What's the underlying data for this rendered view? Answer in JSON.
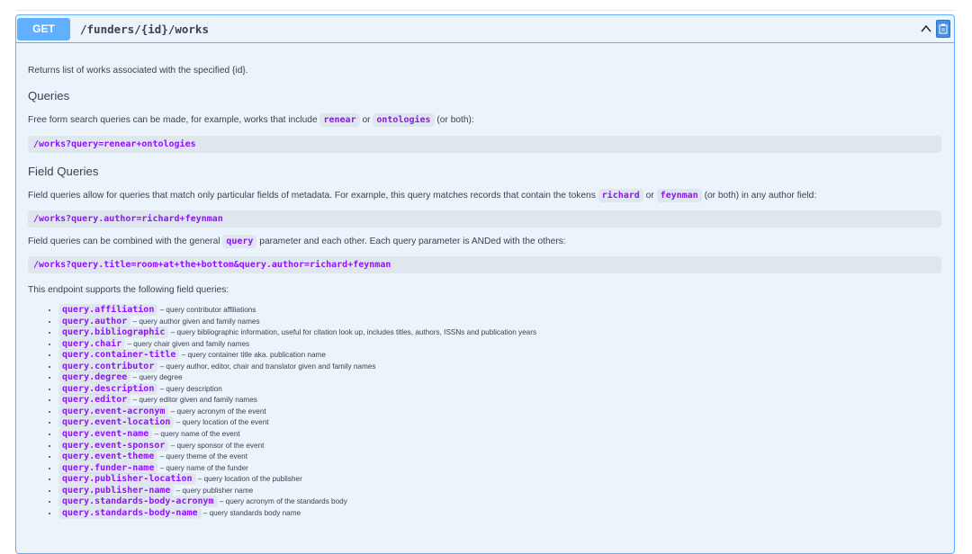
{
  "endpoint": {
    "method": "GET",
    "path": "/funders/{id}/works"
  },
  "intro": "Returns list of works associated with the specified {id}.",
  "queries": {
    "heading": "Queries",
    "text_pre": "Free form search queries can be made, for example, works that include",
    "term1": "renear",
    "or_word": "or",
    "term2": "ontologies",
    "text_post": "(or both):",
    "example": "/works?query=renear+ontologies"
  },
  "field_queries": {
    "heading": "Field Queries",
    "text_pre": "Field queries allow for queries that match only particular fields of metadata. For example, this query matches records that contain the tokens",
    "term1": "richard",
    "or_word": "or",
    "term2": "feynman",
    "text_post": "(or both) in any author field:",
    "example1": "/works?query.author=richard+feynman",
    "combine_pre": "Field queries can be combined with the general",
    "combine_term": "query",
    "combine_post": "parameter and each other. Each query parameter is ANDed with the others:",
    "example2": "/works?query.title=room+at+the+bottom&query.author=richard+feynman",
    "supports_text": "This endpoint supports the following field queries:",
    "items": [
      {
        "name": "query.affiliation",
        "desc": "– query contributor affiliations"
      },
      {
        "name": "query.author",
        "desc": "– query author given and family names"
      },
      {
        "name": "query.bibliographic",
        "desc": "– query bibliographic information, useful for citation look up, includes titles, authors, ISSNs and publication years"
      },
      {
        "name": "query.chair",
        "desc": "– query chair given and family names"
      },
      {
        "name": "query.container-title",
        "desc": "– query container title aka. publication name"
      },
      {
        "name": "query.contributor",
        "desc": "– query author, editor, chair and translator given and family names"
      },
      {
        "name": "query.degree",
        "desc": "– query degree"
      },
      {
        "name": "query.description",
        "desc": "– query description"
      },
      {
        "name": "query.editor",
        "desc": "– query editor given and family names"
      },
      {
        "name": "query.event-acronym",
        "desc": "– query acronym of the event"
      },
      {
        "name": "query.event-location",
        "desc": "– query location of the event"
      },
      {
        "name": "query.event-name",
        "desc": "– query name of the event"
      },
      {
        "name": "query.event-sponsor",
        "desc": "– query sponsor of the event"
      },
      {
        "name": "query.event-theme",
        "desc": "– query theme of the event"
      },
      {
        "name": "query.funder-name",
        "desc": "– query name of the funder"
      },
      {
        "name": "query.publisher-location",
        "desc": "– query location of the publisher"
      },
      {
        "name": "query.publisher-name",
        "desc": "– query publisher name"
      },
      {
        "name": "query.standards-body-acronym",
        "desc": "– query acronym of the standards body"
      },
      {
        "name": "query.standards-body-name",
        "desc": "– query standards body name"
      }
    ]
  },
  "icons": {
    "collapse": "chevron-up-icon",
    "copy": "copy-icon"
  },
  "colors": {
    "get_method": "#61affe",
    "block_bg": "#ebf3fb",
    "code_purple": "#9012fe"
  }
}
